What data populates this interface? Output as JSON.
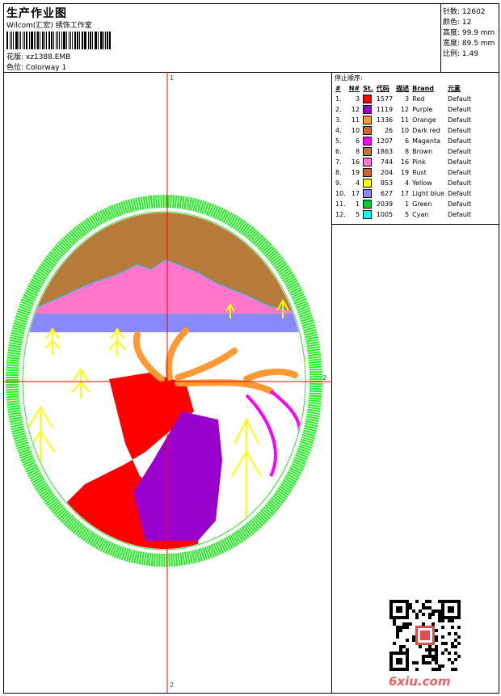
{
  "header": {
    "title": "生产作业图",
    "company": "Wilcom(汇宏) 绣饰工作室",
    "design_label": "花版: xz1388.EMB",
    "colorway_label": "色位: Colorway 1"
  },
  "stats": {
    "stitches": "针数: 12602",
    "colors": "颜色: 12",
    "height": "高度: 99.9 mm",
    "width": "宽度: 89.5 mm",
    "scale": "比例: 1.49"
  },
  "stop_sequence": {
    "title": "停止顺序:",
    "columns": [
      "#",
      "N#",
      "St.",
      "代码",
      "描述",
      "Brand",
      "元素"
    ],
    "rows": [
      {
        "idx": "1.",
        "n": "3",
        "color": "#ff0000",
        "st": "1577",
        "code": "3",
        "desc": "Red",
        "brand": "Default"
      },
      {
        "idx": "2.",
        "n": "12",
        "color": "#9900cc",
        "st": "1119",
        "code": "12",
        "desc": "Purple",
        "brand": "Default"
      },
      {
        "idx": "3.",
        "n": "11",
        "color": "#ff9933",
        "st": "1336",
        "code": "11",
        "desc": "Orange",
        "brand": "Default"
      },
      {
        "idx": "4.",
        "n": "10",
        "color": "#cc6633",
        "st": "26",
        "code": "10",
        "desc": "Dark red",
        "brand": "Default"
      },
      {
        "idx": "5.",
        "n": "6",
        "color": "#ff00ff",
        "st": "1207",
        "code": "6",
        "desc": "Magenta",
        "brand": "Default"
      },
      {
        "idx": "6.",
        "n": "8",
        "color": "#b77a3a",
        "st": "1863",
        "code": "8",
        "desc": "Brown",
        "brand": "Default"
      },
      {
        "idx": "7.",
        "n": "16",
        "color": "#ff77cc",
        "st": "744",
        "code": "16",
        "desc": "Pink",
        "brand": "Default"
      },
      {
        "idx": "8.",
        "n": "19",
        "color": "#cc6633",
        "st": "204",
        "code": "19",
        "desc": "Rust",
        "brand": "Default"
      },
      {
        "idx": "9.",
        "n": "4",
        "color": "#ffff00",
        "st": "853",
        "code": "4",
        "desc": "Yellow",
        "brand": "Default"
      },
      {
        "idx": "10.",
        "n": "17",
        "color": "#8888ff",
        "st": "627",
        "code": "17",
        "desc": "Light blue",
        "brand": "Default"
      },
      {
        "idx": "11.",
        "n": "1",
        "color": "#00cc33",
        "st": "2039",
        "code": "1",
        "desc": "Green",
        "brand": "Default"
      },
      {
        "idx": "12.",
        "n": "5",
        "color": "#00ffff",
        "st": "1005",
        "code": "5",
        "desc": "Cyan",
        "brand": "Default"
      }
    ]
  },
  "axis": {
    "top": "1",
    "bottom": "2",
    "right": "2"
  },
  "watermark": {
    "site": "6xiu.com"
  },
  "colors": {
    "crosshair": "#ff0000",
    "border_ring": "#22ee22",
    "axis_label": "#007000"
  }
}
